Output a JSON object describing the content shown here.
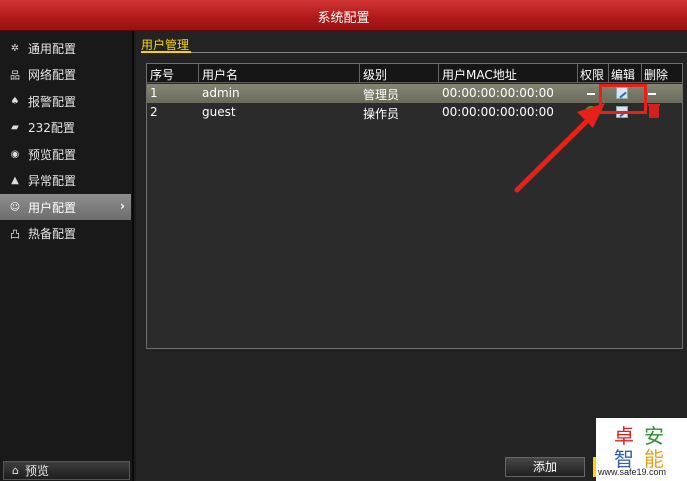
{
  "window": {
    "title": "系统配置"
  },
  "sidebar": {
    "items": [
      {
        "label": "通用配置",
        "icon": "gear-icon",
        "glyph": "✲"
      },
      {
        "label": "网络配置",
        "icon": "network-icon",
        "glyph": "品"
      },
      {
        "label": "报警配置",
        "icon": "alarm-icon",
        "glyph": "♠"
      },
      {
        "label": "232配置",
        "icon": "serial-port-icon",
        "glyph": "▰"
      },
      {
        "label": "预览配置",
        "icon": "eye-icon",
        "glyph": "◉"
      },
      {
        "label": "异常配置",
        "icon": "warning-icon",
        "glyph": "▲"
      },
      {
        "label": "用户配置",
        "icon": "users-icon",
        "glyph": "☺",
        "active": true
      },
      {
        "label": "热备配置",
        "icon": "hot-standby-icon",
        "glyph": "凸"
      }
    ],
    "active_chevron": "›",
    "preview_button": {
      "label": "预览",
      "glyph": "⌂"
    }
  },
  "main": {
    "section_title": "用户管理",
    "table": {
      "columns": [
        "序号",
        "用户名",
        "级别",
        "用户MAC地址",
        "权限",
        "编辑",
        "删除"
      ],
      "rows": [
        {
          "index": "1",
          "username": "admin",
          "level": "管理员",
          "mac": "00:00:00:00:00:00",
          "permission": "none",
          "edit": "edit-icon",
          "delete": "none",
          "selected": true
        },
        {
          "index": "2",
          "username": "guest",
          "level": "操作员",
          "mac": "00:00:00:00:00:00",
          "permission": "check-icon",
          "edit": "edit-icon",
          "delete": "trash-icon",
          "selected": false
        }
      ]
    },
    "add_button": "添加"
  },
  "watermark": {
    "chars": [
      "卓",
      "安",
      "智",
      "能"
    ],
    "url": "www.safe19.com"
  },
  "colors": {
    "title_bar": "#b01818",
    "section_title": "#ffd200",
    "highlight": "#e8201a",
    "selected_row": "#7a7a68"
  }
}
